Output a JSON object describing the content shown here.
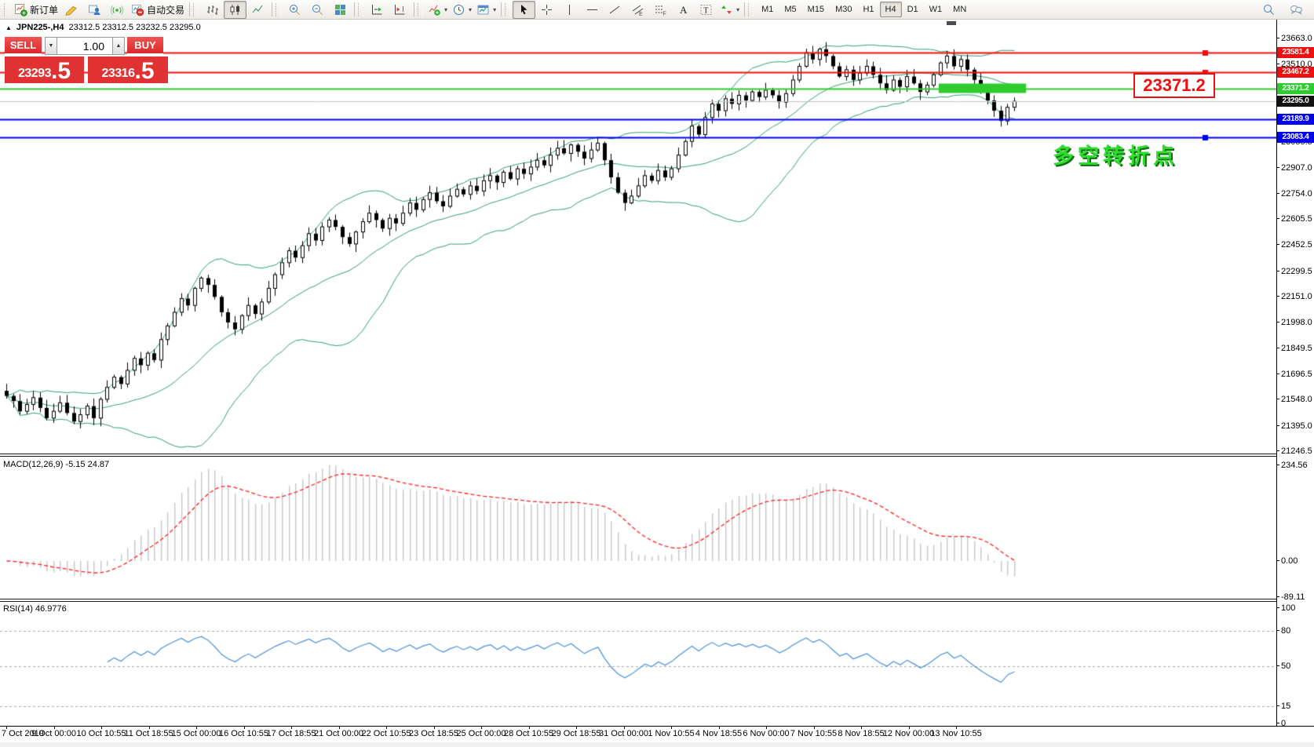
{
  "toolbar": {
    "groups": [
      {
        "items": [
          {
            "name": "new-order",
            "label": "新订单"
          },
          {
            "name": "metaeditor"
          },
          {
            "name": "new-chart"
          },
          {
            "name": "signals"
          },
          {
            "name": "auto-trading",
            "label": "自动交易"
          }
        ]
      },
      {
        "items": [
          {
            "name": "bar-chart"
          },
          {
            "name": "candlestick-chart",
            "active": true
          },
          {
            "name": "line-chart"
          }
        ]
      },
      {
        "items": [
          {
            "name": "zoom-in"
          },
          {
            "name": "zoom-out"
          },
          {
            "name": "tile-windows"
          }
        ]
      },
      {
        "items": [
          {
            "name": "auto-scroll"
          },
          {
            "name": "chart-shift"
          }
        ]
      },
      {
        "items": [
          {
            "name": "indicators",
            "dropdown": true
          },
          {
            "name": "periods",
            "dropdown": true
          },
          {
            "name": "templates",
            "dropdown": true
          }
        ]
      },
      {
        "items": [
          {
            "name": "cursor",
            "active": true
          },
          {
            "name": "crosshair"
          },
          {
            "name": "vertical-line"
          },
          {
            "name": "horizontal-line"
          },
          {
            "name": "trendline"
          },
          {
            "name": "equidistant-channel"
          },
          {
            "name": "fibonacci"
          },
          {
            "name": "text"
          },
          {
            "name": "text-label"
          },
          {
            "name": "arrows",
            "dropdown": true
          }
        ]
      }
    ],
    "timeframes": [
      {
        "label": "M1"
      },
      {
        "label": "M5"
      },
      {
        "label": "M15"
      },
      {
        "label": "M30"
      },
      {
        "label": "H1"
      },
      {
        "label": "H4",
        "active": true
      },
      {
        "label": "D1"
      },
      {
        "label": "W1"
      },
      {
        "label": "MN"
      }
    ],
    "right_items": [
      {
        "name": "search"
      },
      {
        "name": "chat"
      }
    ]
  },
  "chart": {
    "collapse_icon": "▲",
    "symbol_title": "JPN225-,H4",
    "ohlc_text": "23312.5 23312.5 23232.5 23295.0",
    "one_click": {
      "sell_label": "SELL",
      "buy_label": "BUY",
      "volume": "1.00",
      "spin_down": "▼",
      "spin_up": "▲",
      "sell_price": "23293",
      "sell_price_frac": ".5",
      "buy_price": "23316",
      "buy_price_frac": ".5"
    },
    "callout_price": "23371.2",
    "annotation_cn": "多空转折点",
    "price_ticks": [
      "23663.0",
      "23510.0",
      "23055.5",
      "22907.0",
      "22754.0",
      "22605.5",
      "22452.5",
      "22299.5",
      "22151.0",
      "21998.0",
      "21849.5",
      "21696.5",
      "21548.0",
      "21395.0",
      "21246.5"
    ],
    "time_labels": [
      "7 Oct 2019",
      "9 Oct 00:00",
      "10 Oct 10:55",
      "11 Oct 18:55",
      "15 Oct 00:00",
      "16 Oct 10:55",
      "17 Oct 18:55",
      "21 Oct 00:00",
      "22 Oct 10:55",
      "23 Oct 18:55",
      "25 Oct 00:00",
      "28 Oct 10:55",
      "29 Oct 18:55",
      "31 Oct 00:00",
      "1 Nov 10:55",
      "4 Nov 18:55",
      "6 Nov 00:00",
      "7 Nov 10:55",
      "8 Nov 18:55",
      "12 Nov 00:00",
      "13 Nov 10:55"
    ]
  },
  "macd_pane": {
    "label": "MACD(12,26,9) -5.15 24.87",
    "scale": [
      {
        "text": "234.56",
        "value": 234.56
      },
      {
        "text": "0.00",
        "value": 0
      },
      {
        "text": "-89.11",
        "value": -89.11
      }
    ]
  },
  "rsi_pane": {
    "label": "RSI(14) 46.9776",
    "scale": [
      {
        "text": "100",
        "value": 100
      },
      {
        "text": "80",
        "value": 80
      },
      {
        "text": "50",
        "value": 50
      },
      {
        "text": "15",
        "value": 15
      },
      {
        "text": "0",
        "value": 0
      }
    ],
    "dashed_levels": [
      80,
      50,
      15
    ]
  },
  "chart_data": {
    "type": "candlestick",
    "title": "JPN225-,H4",
    "timeframe": "H4",
    "last_ohlc": {
      "open": 23312.5,
      "high": 23312.5,
      "low": 23232.5,
      "close": 23295.0
    },
    "ylim": [
      21246.5,
      23663.0
    ],
    "first_open": 21600,
    "closes": [
      21570,
      21540,
      21480,
      21520,
      21560,
      21500,
      21440,
      21480,
      21530,
      21470,
      21420,
      21460,
      21510,
      21440,
      21550,
      21620,
      21680,
      21640,
      21720,
      21790,
      21750,
      21820,
      21780,
      21900,
      21980,
      22060,
      22140,
      22100,
      22200,
      22260,
      22220,
      22150,
      22060,
      22000,
      21960,
      22040,
      22100,
      22050,
      22120,
      22200,
      22280,
      22350,
      22420,
      22380,
      22450,
      22520,
      22480,
      22560,
      22600,
      22560,
      22500,
      22460,
      22530,
      22590,
      22640,
      22600,
      22550,
      22610,
      22580,
      22640,
      22700,
      22660,
      22720,
      22760,
      22710,
      22680,
      22740,
      22780,
      22750,
      22800,
      22770,
      22830,
      22860,
      22820,
      22880,
      22840,
      22900,
      22870,
      22910,
      22950,
      22920,
      22980,
      23020,
      22990,
      23040,
      23000,
      22960,
      23010,
      23050,
      22950,
      22850,
      22760,
      22700,
      22740,
      22800,
      22860,
      22830,
      22890,
      22850,
      22900,
      22980,
      23060,
      23150,
      23100,
      23200,
      23280,
      23240,
      23310,
      23280,
      23330,
      23300,
      23350,
      23320,
      23360,
      23330,
      23290,
      23340,
      23420,
      23500,
      23580,
      23540,
      23600,
      23560,
      23500,
      23440,
      23480,
      23420,
      23460,
      23500,
      23450,
      23400,
      23360,
      23420,
      23380,
      23440,
      23400,
      23350,
      23390,
      23450,
      23520,
      23560,
      23500,
      23540,
      23480,
      23420,
      23360,
      23300,
      23240,
      23180,
      23260,
      23295
    ],
    "indicators": {
      "bollinger": {
        "period": 20,
        "deviation": 2,
        "color": "#2f9e6e"
      },
      "macd": {
        "fast": 12,
        "slow": 26,
        "signal": 9,
        "current_main": -5.15,
        "current_signal": 24.87,
        "histogram_color": "#c6c6c6",
        "signal_color": "#ff2020"
      },
      "rsi": {
        "period": 14,
        "current": 46.9776,
        "color": "#4a90d9"
      }
    },
    "hlines": [
      {
        "price": 23581.4,
        "label": "23581.4",
        "line_color": "#ee1010",
        "badge_bg": "#ee1010",
        "width": 2,
        "anchor": true
      },
      {
        "price": 23467.2,
        "label": "23467.2",
        "line_color": "#ee1010",
        "badge_bg": "#ee1010",
        "width": 2,
        "anchor": true
      },
      {
        "price": 23371.2,
        "label": "23371.2",
        "line_color": "#2ecc2e",
        "badge_bg": "#2ecc2e",
        "width": 2,
        "anchor": true
      },
      {
        "price": 23295.0,
        "label": "23295.0",
        "line_color": "#c0c0c0",
        "badge_bg": "#111111",
        "width": 1,
        "anchor": false
      },
      {
        "price": 23189.9,
        "label": "23189.9",
        "line_color": "#0000ee",
        "badge_bg": "#0000ee",
        "width": 2,
        "anchor": false
      },
      {
        "price": 23083.4,
        "label": "23083.4",
        "line_color": "#0000ee",
        "badge_bg": "#0000ee",
        "width": 2,
        "anchor": true
      }
    ],
    "highlight_band": {
      "price": 23371.2,
      "from_bar": 139,
      "to_bar": 152,
      "color": "#2ecc2e",
      "height": 12
    }
  }
}
